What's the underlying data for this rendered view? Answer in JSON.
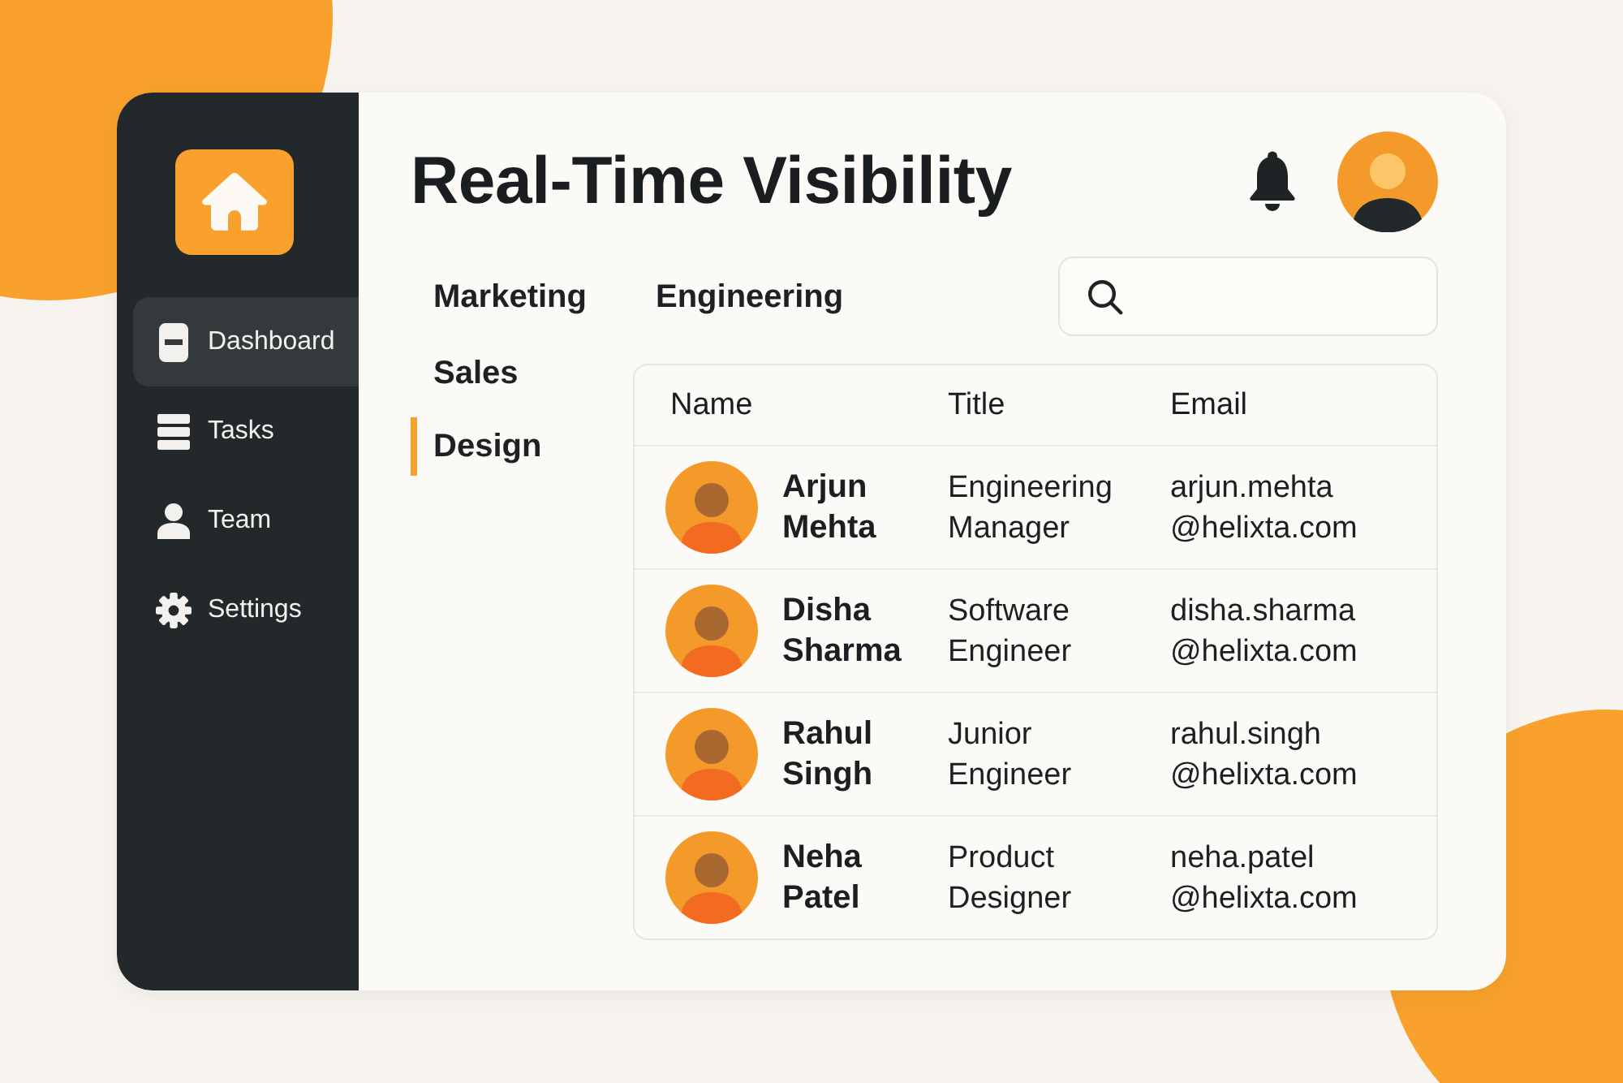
{
  "sidebar": {
    "items": [
      {
        "label": "Dashboard",
        "selected": true
      },
      {
        "label": "Tasks",
        "selected": false
      },
      {
        "label": "Team",
        "selected": false
      },
      {
        "label": "Settings",
        "selected": false
      }
    ]
  },
  "header": {
    "title": "Real-Time Visibility"
  },
  "departments": [
    {
      "label": "Marketing",
      "selected": false
    },
    {
      "label": "Engineering",
      "selected": false
    },
    {
      "label": "Sales",
      "selected": false
    },
    {
      "label": "Design",
      "selected": true
    }
  ],
  "table": {
    "columns": [
      "Name",
      "Title",
      "Email"
    ],
    "rows": [
      {
        "name": "Arjun Mehta",
        "title": "Engineering Manager",
        "email": "arjun.mehta@helixta.com"
      },
      {
        "name": "Disha Sharma",
        "title": "Software Engineer",
        "email": "disha.sharma@helixta.com"
      },
      {
        "name": "Rahul Singh",
        "title": "Junior Engineer",
        "email": "rahul.singh@helixta.com"
      },
      {
        "name": "Neha Patel",
        "title": "Product Designer",
        "email": "neha.patel@helixta.com"
      }
    ]
  }
}
